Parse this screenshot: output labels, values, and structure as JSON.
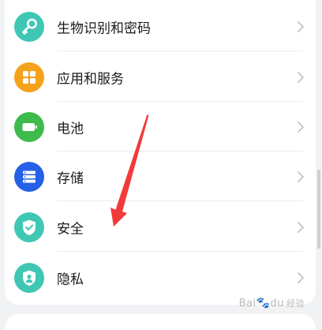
{
  "settings": {
    "items": [
      {
        "label": "生物识别和密码",
        "icon": "key-icon",
        "color": "#3fc7b4"
      },
      {
        "label": "应用和服务",
        "icon": "apps-grid-icon",
        "color": "#f5a21b"
      },
      {
        "label": "电池",
        "icon": "battery-icon",
        "color": "#3dbb4d"
      },
      {
        "label": "存储",
        "icon": "storage-icon",
        "color": "#2561e6"
      },
      {
        "label": "安全",
        "icon": "shield-check-icon",
        "color": "#3fc7b4"
      },
      {
        "label": "隐私",
        "icon": "privacy-shield-icon",
        "color": "#3fc7b4"
      }
    ]
  },
  "annotation": {
    "arrow_color": "#f23a3a"
  },
  "watermark": {
    "brand": "Bai",
    "brand_end": "du",
    "sub": "经验"
  }
}
